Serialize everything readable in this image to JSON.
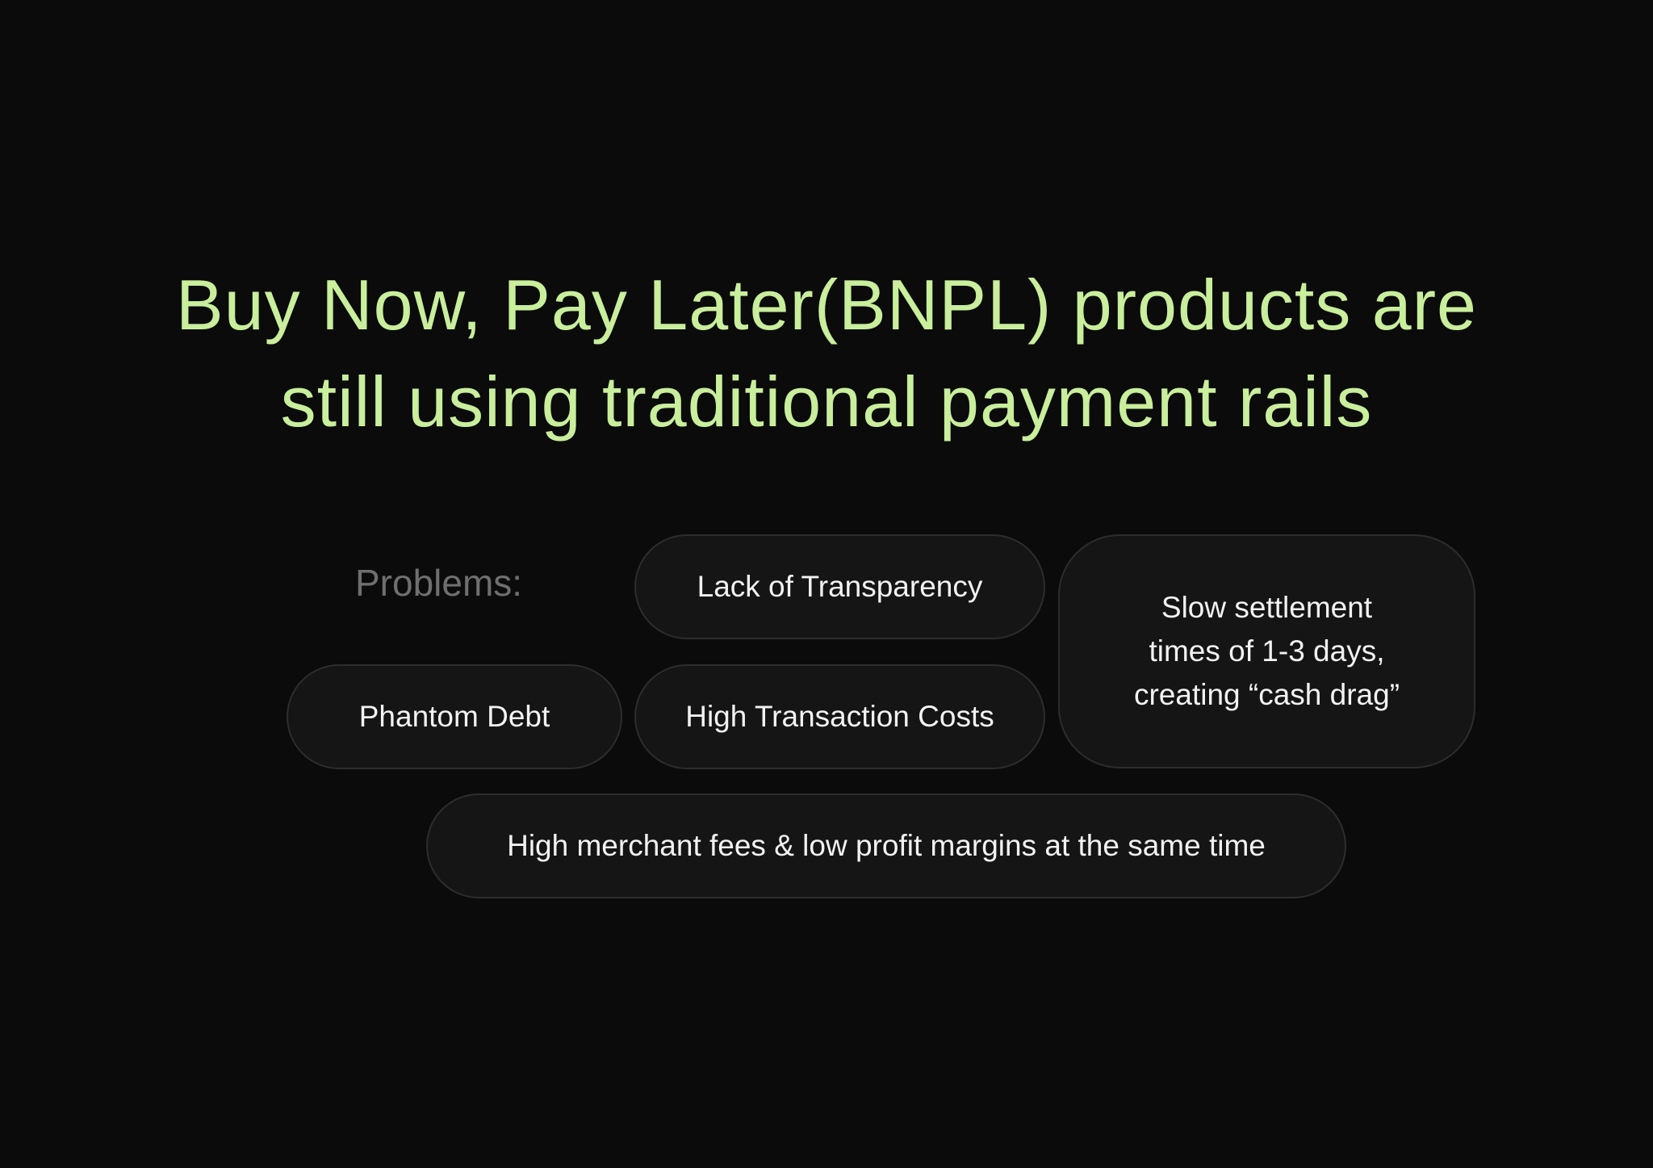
{
  "title": {
    "line1": "Buy Now, Pay Later(BNPL) products are",
    "line2": "still using traditional payment rails"
  },
  "problems": {
    "label": "Problems:",
    "items": [
      {
        "text": "Lack of Transparency"
      },
      {
        "lines": [
          "Slow settlement",
          "times of 1-3 days,",
          "creating “cash drag”"
        ]
      },
      {
        "text": "Phantom Debt"
      },
      {
        "text": "High Transaction Costs"
      },
      {
        "text": "High merchant fees & low profit margins at the same time"
      }
    ]
  },
  "colors": {
    "background": "#0b0b0b",
    "title": "#c9ee9c",
    "label": "#6f6f6f",
    "pill_fill": "#151515",
    "pill_border": "#2d2d2d",
    "pill_text": "#f2f2f2"
  }
}
